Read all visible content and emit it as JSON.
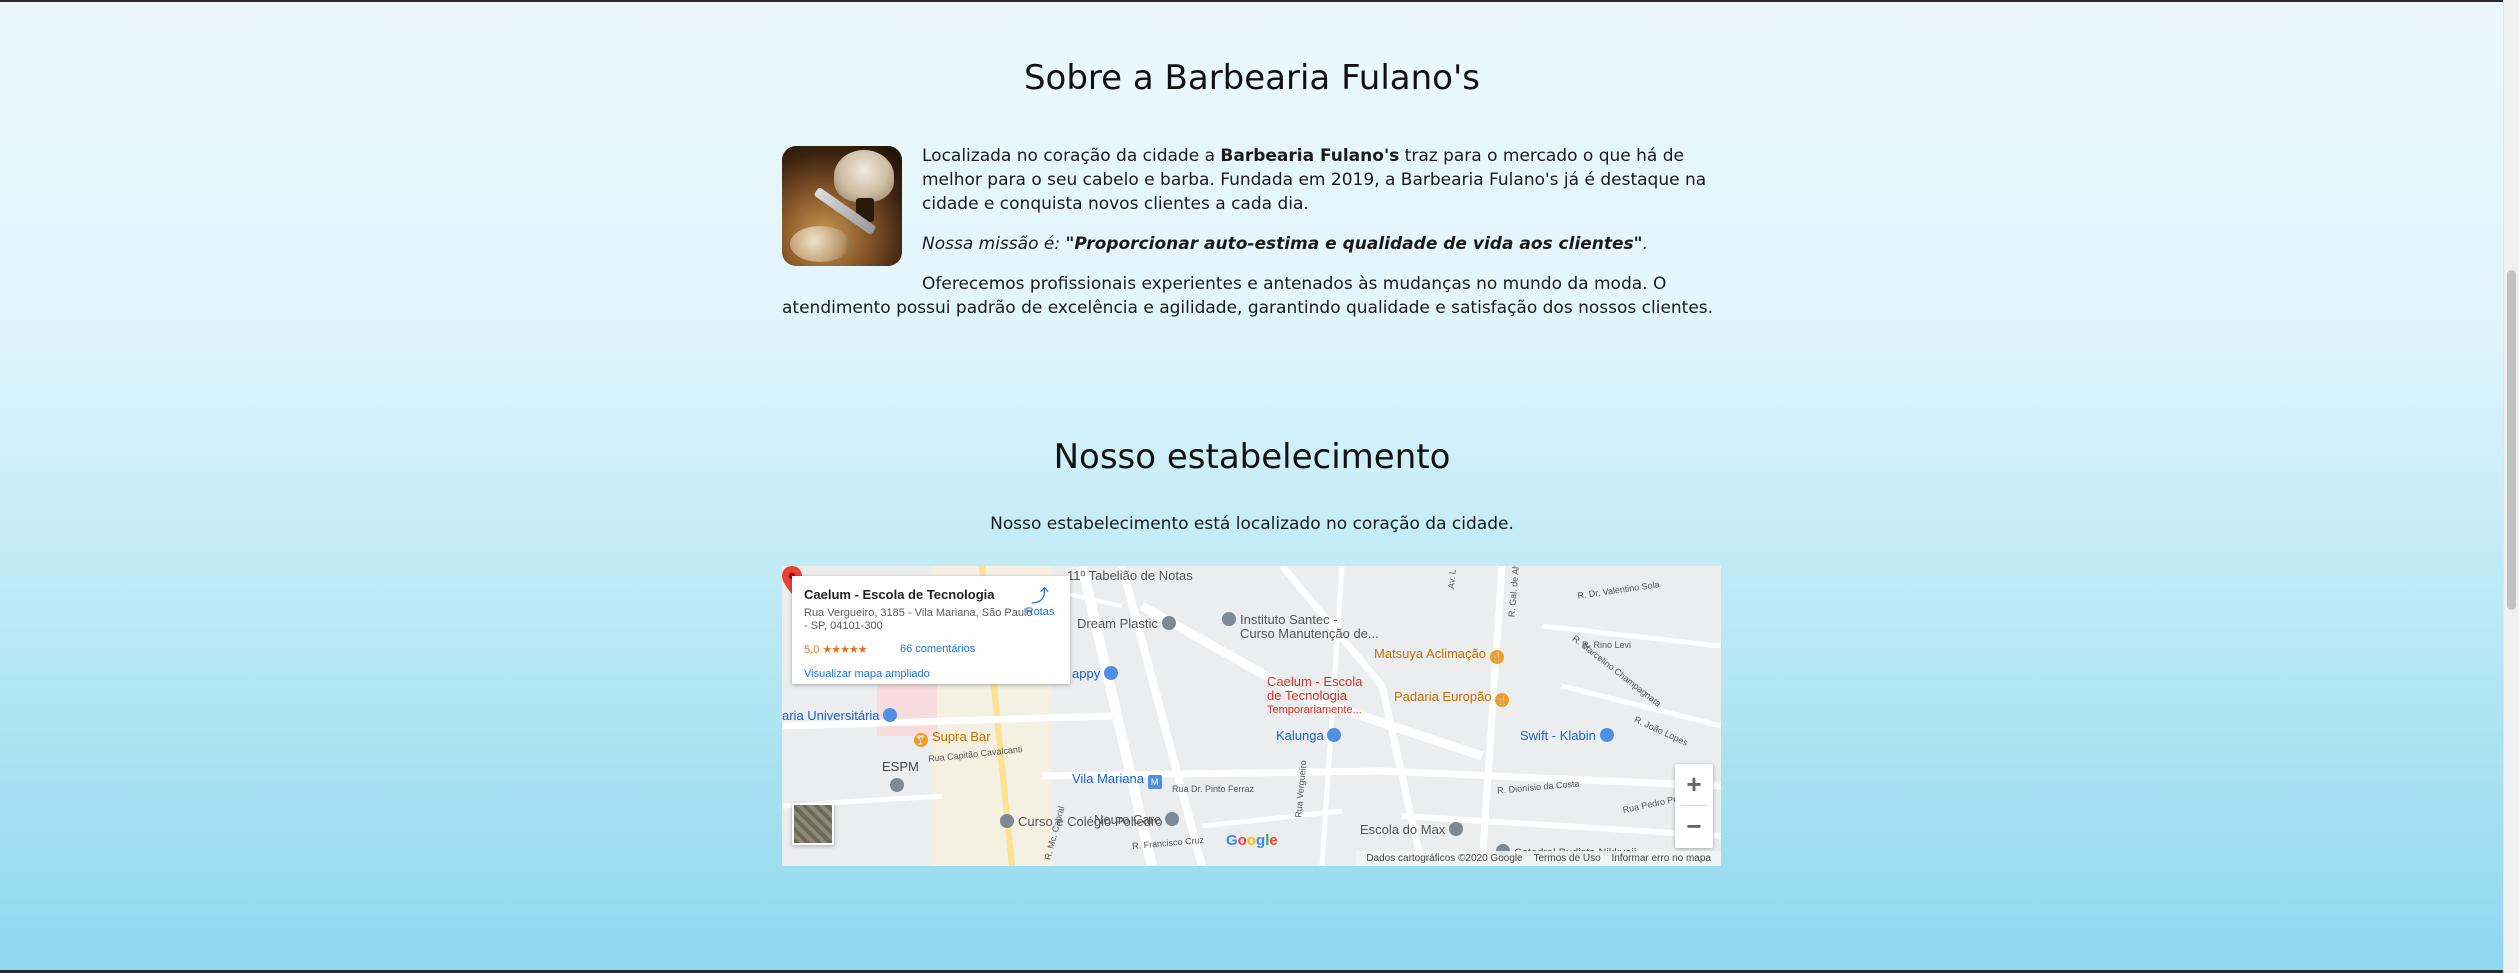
{
  "about": {
    "title": "Sobre a Barbearia Fulano's",
    "p1_pre": "Localizada no coração da cidade a ",
    "p1_bold": "Barbearia Fulano's",
    "p1_post": " traz para o mercado o que há de melhor para o seu cabelo e barba. Fundada em 2019, a Barbearia Fulano's já é destaque na cidade e conquista novos clientes a cada dia.",
    "mission_pre": "Nossa missão é: ",
    "mission_bold": "\"Proporcionar auto-estima e qualidade de vida aos clientes\"",
    "mission_post": ".",
    "p3": "Oferecemos profissionais experientes e antenados às mudanças no mundo da moda. O atendimento possui padrão de excelência e agilidade, garantindo qualidade e satisfação dos nossos clientes."
  },
  "store": {
    "title": "Nosso estabelecimento",
    "subtitle": "Nosso estabelecimento está localizado no coração da cidade."
  },
  "map": {
    "card": {
      "name": "Caelum - Escola de Tecnologia",
      "address": "Rua Vergueiro, 3185 - Vila Mariana, São Paulo - SP, 04101-300",
      "rating": "5,0",
      "stars": "★★★★★",
      "reviews": "66 comentários",
      "larger_map": "Visualizar mapa ampliado",
      "routes": "Rotas"
    },
    "pin_label_1": "Caelum - Escola",
    "pin_label_2": "de Tecnologia",
    "pin_label_3": "Temporariamente...",
    "labels": {
      "tabeliao": "11º Tabelião de Notas",
      "dream": "Dream Plastic",
      "santec_1": "Instituto Santec -",
      "santec_2": "Curso Manutenção de...",
      "matsuya": "Matsuya Aclimação",
      "padaria": "Padaria Europão",
      "kalunga": "Kalunga",
      "swift": "Swift - Klabin",
      "supra": "Supra Bar",
      "universitaria": "aria Universitária",
      "espm": "ESPM",
      "vila_mariana": "Vila Mariana",
      "poliedro": "Curso e Colégio Poliedro",
      "neuro": "Neuro Care",
      "escola_max": "Escola do Max",
      "catedral": "Catedral Budista Nikkyoji",
      "appy": "appy"
    },
    "streets": {
      "valentino": "R. Dr. Valentino Sola",
      "levi": "R. Rino Levi",
      "champagnata": "R. Marcelino Champagnata",
      "joao": "R. João Lopes",
      "dionisio": "R. Dionísio da Costa",
      "pedro": "Rua Pedro Pomp",
      "vergueiro": "Rua Vergueiro",
      "capitao": "Rua Capitão Cavalcanti",
      "ferraz": "Rua Dr. Pinto Ferraz",
      "francisco": "R. Francisco Cruz",
      "cabral": "R. Mc. Cabral",
      "alves": "R. Gal. de Alves",
      "av": "Av. L"
    },
    "zoom_in": "+",
    "zoom_out": "−",
    "google": [
      "G",
      "o",
      "o",
      "g",
      "l",
      "e"
    ],
    "attribution": {
      "data": "Dados cartográficos ©2020 Google",
      "terms": "Termos de Uso",
      "report": "Informar erro no mapa"
    }
  }
}
